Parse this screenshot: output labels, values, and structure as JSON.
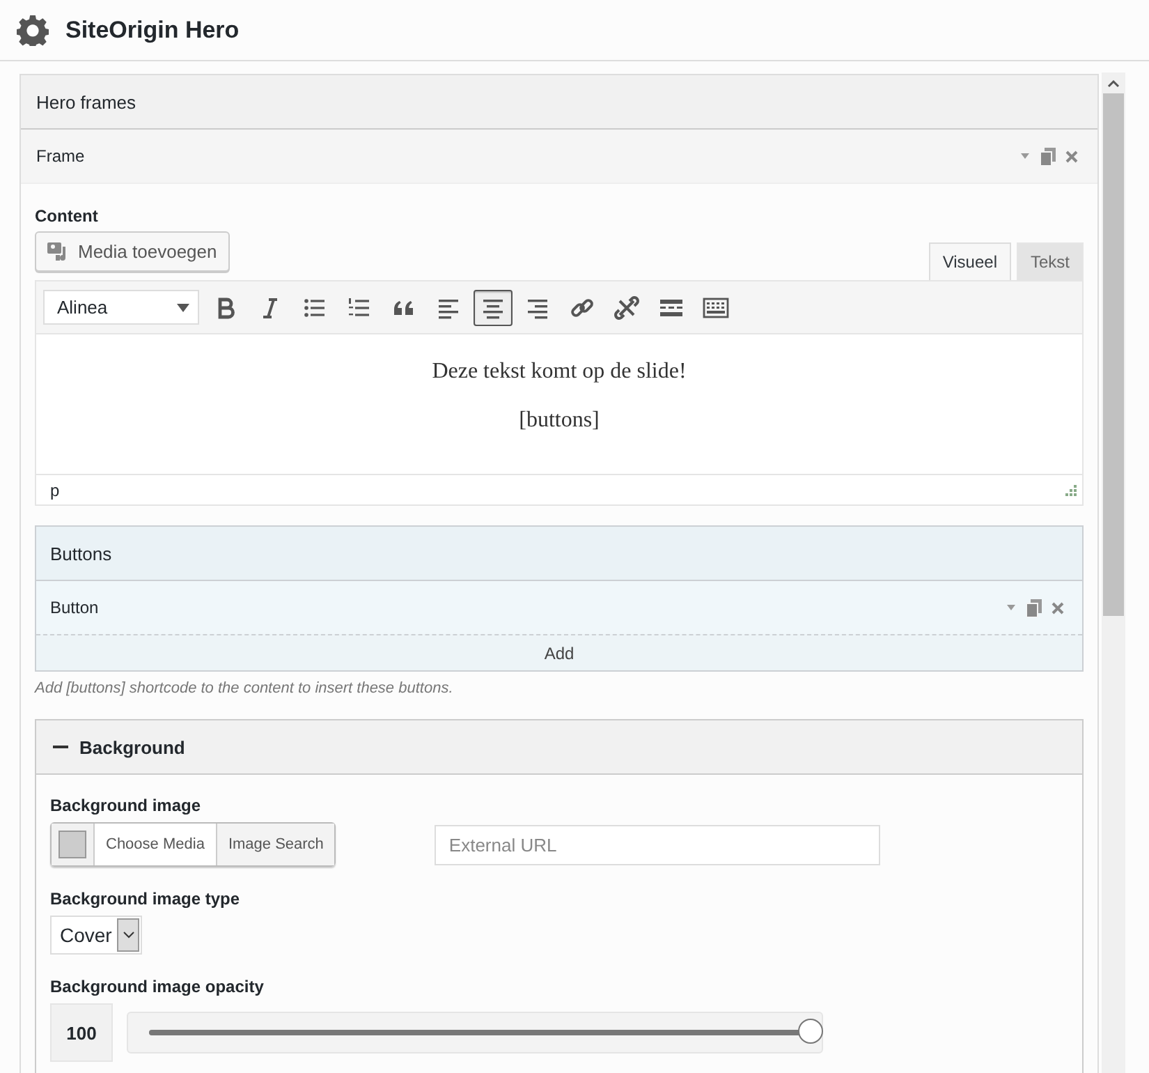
{
  "window": {
    "title": "SiteOrigin Hero"
  },
  "hero_frames": {
    "title": "Hero frames",
    "frame": {
      "title": "Frame"
    }
  },
  "content": {
    "label": "Content",
    "media_button": "Media toevoegen",
    "tabs": [
      {
        "label": "Visueel",
        "selected": true
      },
      {
        "label": "Tekst",
        "selected": false
      }
    ],
    "format_select": "Alinea",
    "toolbar": [
      {
        "kind": "bold",
        "selected": false
      },
      {
        "kind": "italic",
        "selected": false
      },
      {
        "kind": "bullets",
        "selected": false
      },
      {
        "kind": "numbers",
        "selected": false
      },
      {
        "kind": "quote",
        "selected": false
      },
      {
        "kind": "align-left",
        "selected": false
      },
      {
        "kind": "align-center",
        "selected": true
      },
      {
        "kind": "align-right",
        "selected": false
      },
      {
        "kind": "link",
        "selected": false
      },
      {
        "kind": "unlink",
        "selected": false
      },
      {
        "kind": "more",
        "selected": false
      },
      {
        "kind": "toolbar",
        "selected": false
      }
    ],
    "paragraphs": [
      "Deze tekst komt op de slide!",
      "[buttons]"
    ],
    "path": "p"
  },
  "buttons": {
    "title": "Buttons",
    "items": [
      {
        "title": "Button"
      }
    ],
    "add": "Add",
    "hint": "Add [buttons] shortcode to the content to insert these buttons."
  },
  "background": {
    "title": "Background",
    "expanded": true,
    "image": {
      "label": "Background image",
      "choose": "Choose Media",
      "search": "Image Search",
      "url_placeholder": "External URL"
    },
    "image_type": {
      "label": "Background image type",
      "value": "Cover"
    },
    "opacity": {
      "label": "Background image opacity",
      "value": "100",
      "level": 1
    }
  }
}
